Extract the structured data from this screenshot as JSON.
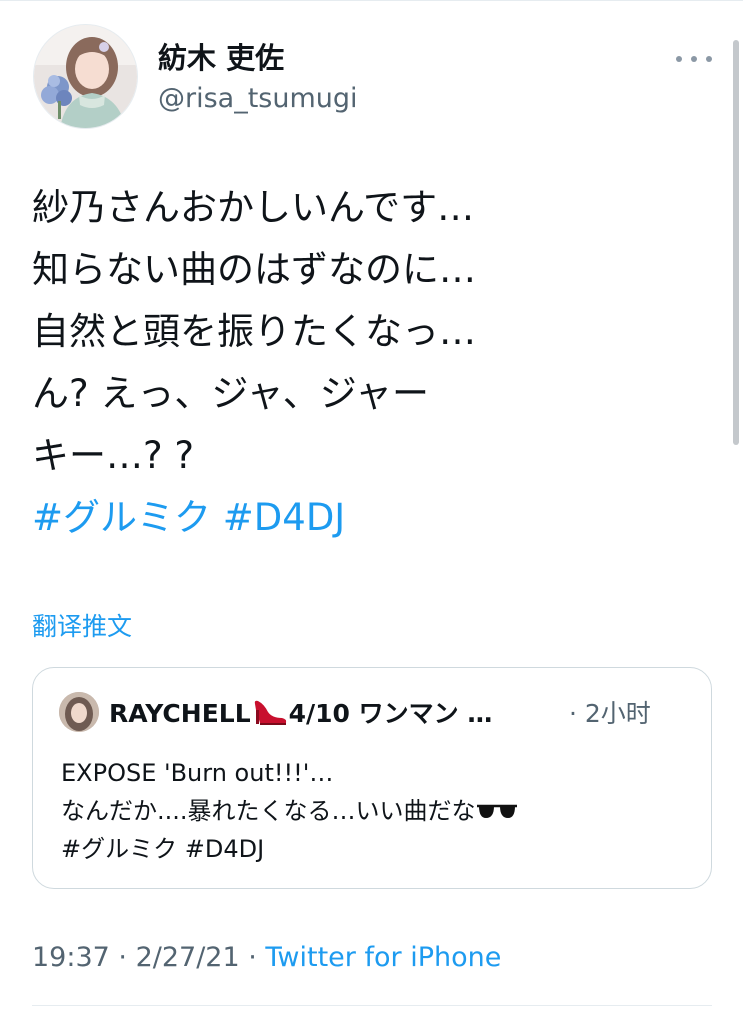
{
  "author": {
    "display_name": "紡木 吏佐",
    "handle": "@risa_tsumugi"
  },
  "tweet": {
    "lines": [
      "紗乃さんおかしいんです…",
      "知らない曲のはずなのに…",
      "自然と頭を振りたくなっ…",
      "ん? えっ、ジャ、ジャー",
      "キー…? ?"
    ],
    "hashtags": [
      "#グルミク",
      "#D4DJ"
    ]
  },
  "translate_label": "翻译推文",
  "quoted_tweet": {
    "author_name_prefix": "RAYCHELL",
    "author_name_suffix": "4/10 ワンマン …",
    "time": "· 2小时",
    "lines": [
      "EXPOSE 'Burn out!!!'…",
      "なんだか....暴れたくなる…いい曲だな"
    ],
    "hashtags_line": "#グルミク #D4DJ"
  },
  "meta": {
    "time": "19:37",
    "separator1": " · ",
    "date": "2/27/21",
    "separator2": " · ",
    "source": "Twitter for iPhone"
  },
  "colors": {
    "link": "#1d9bf0",
    "secondary_text": "#536471",
    "border": "#cfd9de"
  }
}
